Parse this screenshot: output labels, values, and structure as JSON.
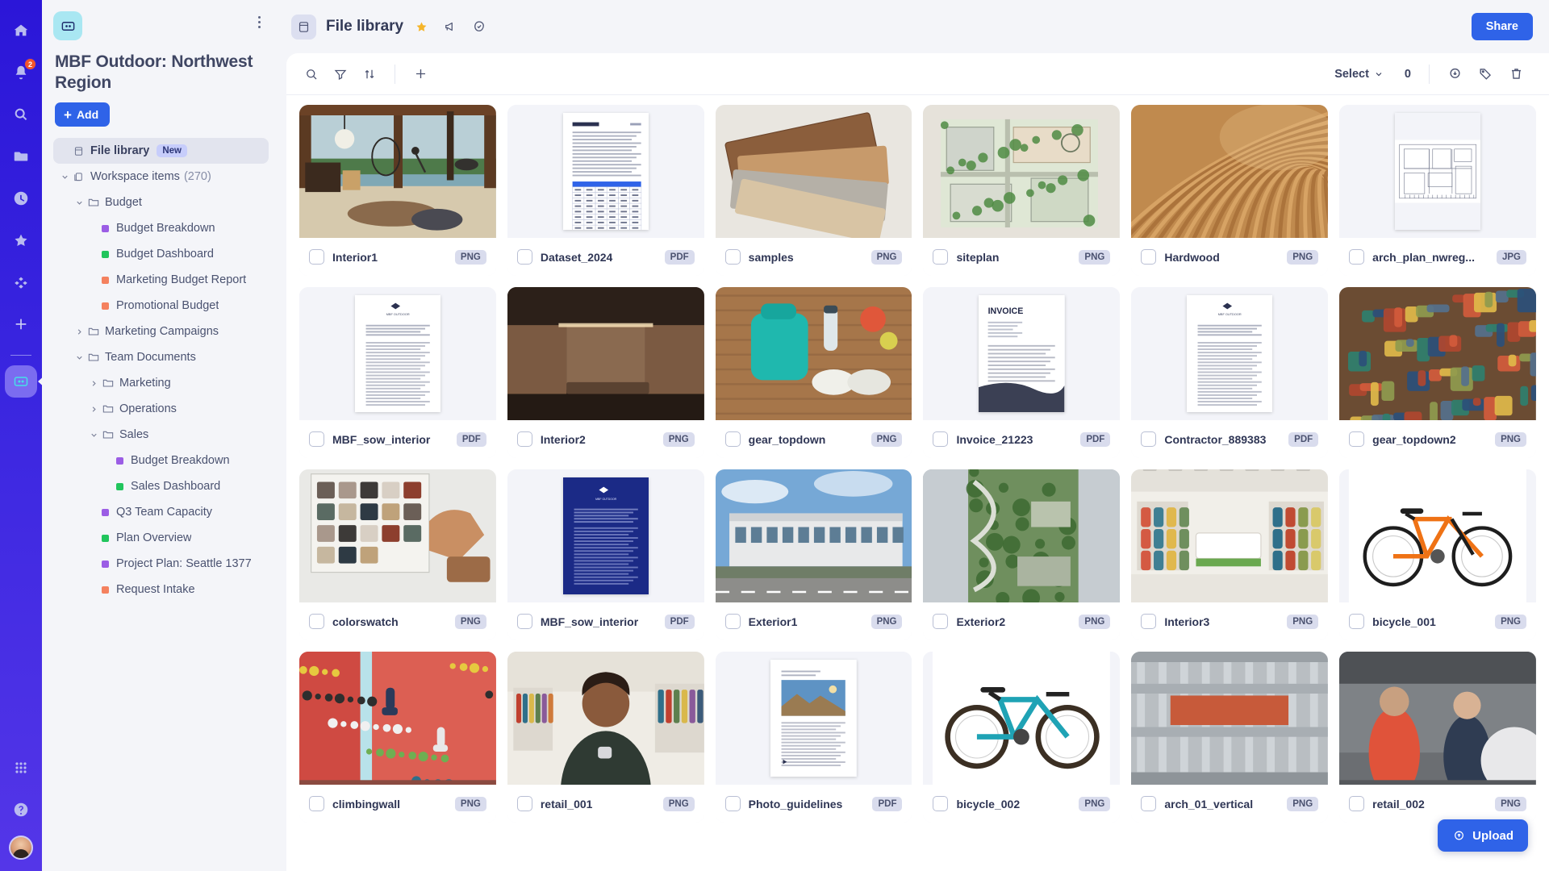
{
  "rail": {
    "items": [
      {
        "name": "home-icon",
        "badge": null
      },
      {
        "name": "notifications-bell-icon",
        "badge": "2"
      },
      {
        "name": "search-icon",
        "badge": null
      },
      {
        "name": "folder-icon",
        "badge": null
      },
      {
        "name": "recent-clock-icon",
        "badge": null
      },
      {
        "name": "favorites-star-icon",
        "badge": null
      },
      {
        "name": "apps-diamond-icon",
        "badge": null
      },
      {
        "name": "add-plus-icon",
        "badge": null
      }
    ],
    "active_workspace_icon": "workspace-icon",
    "bottom": [
      {
        "name": "app-switcher-grid-icon"
      },
      {
        "name": "help-question-icon"
      },
      {
        "name": "user-avatar"
      }
    ]
  },
  "sidebar": {
    "workspace_logo_icon": "workspace-logo-icon",
    "menu_icon": "kebab-menu-icon",
    "title": "MBF Outdoor: Northwest Region",
    "add_label": "Add",
    "tree": [
      {
        "label": "File library",
        "indent": 1,
        "icon": "library-icon",
        "chevron": "",
        "badge": "New",
        "selected": true,
        "dot": null
      },
      {
        "label": "Workspace items",
        "indent": 1,
        "icon": "items-icon",
        "chevron": "down",
        "count": "(270)",
        "selected": false,
        "dot": null
      },
      {
        "label": "Budget",
        "indent": 2,
        "icon": "folder-icon",
        "chevron": "down",
        "selected": false,
        "dot": null
      },
      {
        "label": "Budget Breakdown",
        "indent": 3,
        "icon": null,
        "chevron": "",
        "selected": false,
        "dot": "#9b5de5"
      },
      {
        "label": "Budget Dashboard",
        "indent": 3,
        "icon": null,
        "chevron": "",
        "selected": false,
        "dot": "#21c55d"
      },
      {
        "label": "Marketing Budget Report",
        "indent": 3,
        "icon": null,
        "chevron": "",
        "selected": false,
        "dot": "#f4815f"
      },
      {
        "label": "Promotional Budget",
        "indent": 3,
        "icon": null,
        "chevron": "",
        "selected": false,
        "dot": "#f4815f"
      },
      {
        "label": "Marketing Campaigns",
        "indent": 2,
        "icon": "folder-icon",
        "chevron": "right",
        "selected": false,
        "dot": null
      },
      {
        "label": "Team Documents",
        "indent": 2,
        "icon": "folder-icon",
        "chevron": "down",
        "selected": false,
        "dot": null
      },
      {
        "label": "Marketing",
        "indent": 3,
        "icon": "folder-icon",
        "chevron": "right",
        "selected": false,
        "dot": null
      },
      {
        "label": "Operations",
        "indent": 3,
        "icon": "folder-icon",
        "chevron": "right",
        "selected": false,
        "dot": null
      },
      {
        "label": "Sales",
        "indent": 3,
        "icon": "folder-icon",
        "chevron": "down",
        "selected": false,
        "dot": null
      },
      {
        "label": "Budget Breakdown",
        "indent": 4,
        "icon": null,
        "chevron": "",
        "selected": false,
        "dot": "#9b5de5"
      },
      {
        "label": "Sales Dashboard",
        "indent": 4,
        "icon": null,
        "chevron": "",
        "selected": false,
        "dot": "#21c55d"
      },
      {
        "label": "Q3 Team Capacity",
        "indent": 3,
        "icon": null,
        "chevron": "",
        "selected": false,
        "dot": "#9b5de5"
      },
      {
        "label": "Plan Overview",
        "indent": 3,
        "icon": null,
        "chevron": "",
        "selected": false,
        "dot": "#21c55d"
      },
      {
        "label": "Project Plan: Seattle 1377",
        "indent": 3,
        "icon": null,
        "chevron": "",
        "selected": false,
        "dot": "#9b5de5"
      },
      {
        "label": "Request Intake",
        "indent": 3,
        "icon": null,
        "chevron": "",
        "selected": false,
        "dot": "#f4815f"
      }
    ]
  },
  "topbar": {
    "tab_icon": "library-icon",
    "title": "File library",
    "star_icon": "star-filled-icon",
    "announce_icon": "megaphone-icon",
    "status_icon": "check-cloud-icon",
    "share_label": "Share"
  },
  "toolbar": {
    "search_icon": "search-icon",
    "filter_icon": "filter-icon",
    "sort_icon": "sort-icon",
    "add_icon": "plus-icon",
    "select_label": "Select",
    "chevron_icon": "chevron-down-icon",
    "selected_count": "0",
    "download_icon": "cloud-download-icon",
    "tag_icon": "tag-icon",
    "delete_icon": "trash-icon"
  },
  "upload": {
    "label": "Upload",
    "icon": "upload-cloud-icon"
  },
  "files": [
    {
      "name": "Interior1",
      "type": "PNG",
      "thumb": "interior-lake-room"
    },
    {
      "name": "Dataset_2024",
      "type": "PDF",
      "thumb": "doc-table"
    },
    {
      "name": "samples",
      "type": "PNG",
      "thumb": "wood-samples"
    },
    {
      "name": "siteplan",
      "type": "PNG",
      "thumb": "siteplan-map"
    },
    {
      "name": "Hardwood",
      "type": "PNG",
      "thumb": "hardwood-swirl"
    },
    {
      "name": "arch_plan_nwreg...",
      "type": "JPG",
      "thumb": "blueprint"
    },
    {
      "name": "MBF_sow_interior",
      "type": "PDF",
      "thumb": "doc-white"
    },
    {
      "name": "Interior2",
      "type": "PNG",
      "thumb": "interior-bench"
    },
    {
      "name": "gear_topdown",
      "type": "PNG",
      "thumb": "gear-flatlay"
    },
    {
      "name": "Invoice_21223",
      "type": "PDF",
      "thumb": "doc-invoice"
    },
    {
      "name": "Contractor_889383",
      "type": "PDF",
      "thumb": "doc-white"
    },
    {
      "name": "gear_topdown2",
      "type": "PNG",
      "thumb": "gear-wall"
    },
    {
      "name": "colorswatch",
      "type": "PNG",
      "thumb": "colorswatch"
    },
    {
      "name": "MBF_sow_interior",
      "type": "PDF",
      "thumb": "doc-blue"
    },
    {
      "name": "Exterior1",
      "type": "PNG",
      "thumb": "exterior-building"
    },
    {
      "name": "Exterior2",
      "type": "PNG",
      "thumb": "exterior-aerial"
    },
    {
      "name": "Interior3",
      "type": "PNG",
      "thumb": "retail-interior"
    },
    {
      "name": "bicycle_001",
      "type": "PNG",
      "thumb": "bicycle-orange"
    },
    {
      "name": "climbingwall",
      "type": "PNG",
      "thumb": "climbing-wall"
    },
    {
      "name": "retail_001",
      "type": "PNG",
      "thumb": "retail-person"
    },
    {
      "name": "Photo_guidelines",
      "type": "PDF",
      "thumb": "doc-photo"
    },
    {
      "name": "bicycle_002",
      "type": "PNG",
      "thumb": "bicycle-teal"
    },
    {
      "name": "arch_01_vertical",
      "type": "PNG",
      "thumb": "arch-vertical"
    },
    {
      "name": "retail_002",
      "type": "PNG",
      "thumb": "retail-store"
    }
  ]
}
